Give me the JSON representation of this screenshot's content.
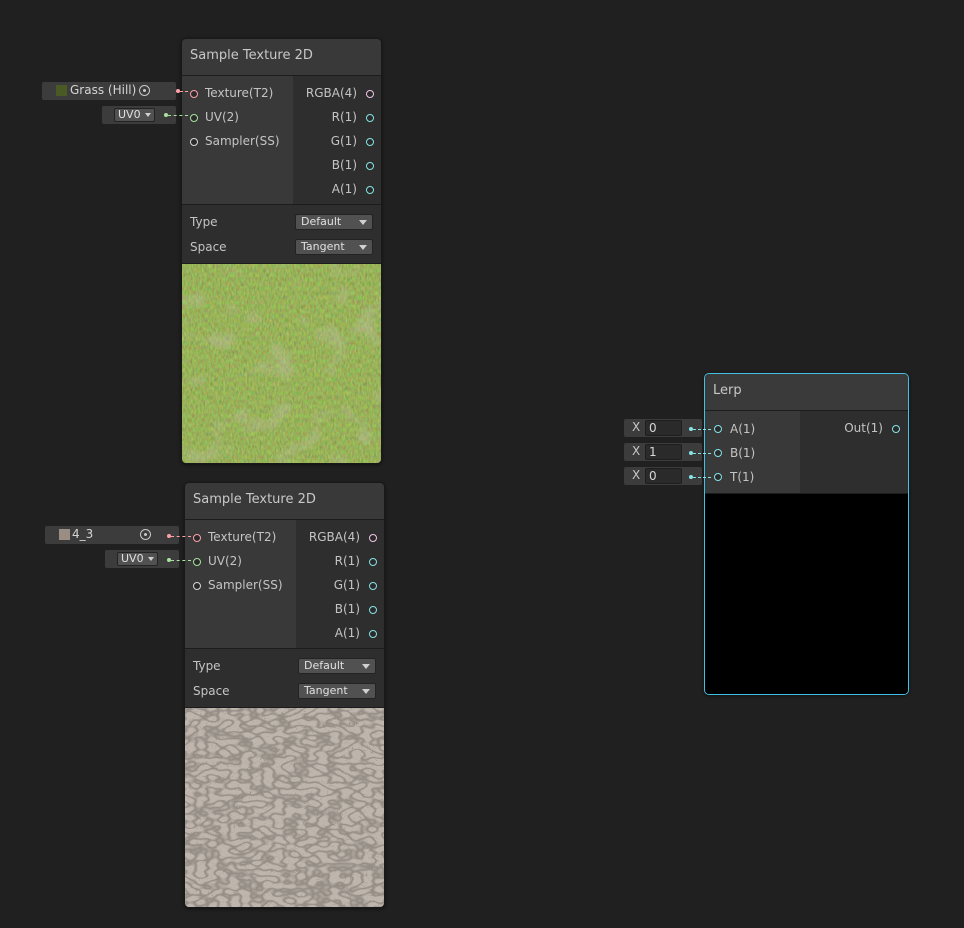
{
  "node1": {
    "title": "Sample Texture 2D",
    "inputs": [
      "Texture(T2)",
      "UV(2)",
      "Sampler(SS)"
    ],
    "outputs": [
      "RGBA(4)",
      "R(1)",
      "G(1)",
      "B(1)",
      "A(1)"
    ],
    "type_label": "Type",
    "type_value": "Default",
    "space_label": "Space",
    "space_value": "Tangent",
    "texture_field": "Grass (Hill)",
    "uv_value": "UV0"
  },
  "node2": {
    "title": "Sample Texture 2D",
    "inputs": [
      "Texture(T2)",
      "UV(2)",
      "Sampler(SS)"
    ],
    "outputs": [
      "RGBA(4)",
      "R(1)",
      "G(1)",
      "B(1)",
      "A(1)"
    ],
    "type_label": "Type",
    "type_value": "Default",
    "space_label": "Space",
    "space_value": "Tangent",
    "texture_field": "4_3",
    "uv_value": "UV0"
  },
  "lerp": {
    "title": "Lerp",
    "inputs": [
      "A(1)",
      "B(1)",
      "T(1)"
    ],
    "output": "Out(1)",
    "x_label": "X",
    "values": [
      "0",
      "1",
      "0"
    ]
  },
  "colors": {
    "background": "#202020",
    "selection": "#44c0e4",
    "texture_port": "#ff9fa8",
    "uv_port": "#a9e3a0",
    "vector1_port": "#84e4e7",
    "grass_swatch": "#4a5a24",
    "stone_swatch": "#9a8d83"
  }
}
